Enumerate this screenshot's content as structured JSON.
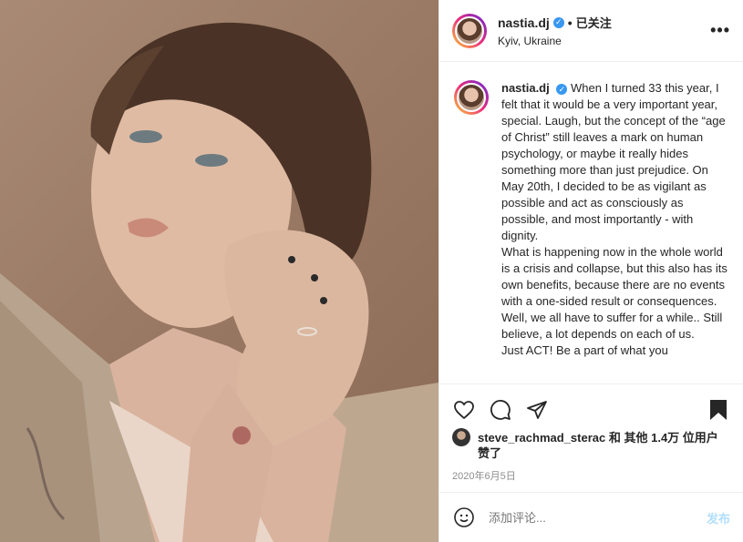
{
  "post": {
    "author": {
      "username": "nastia.dj",
      "verified": true,
      "follow_label": "已关注",
      "location": "Kyiv, Ukraine"
    },
    "caption": {
      "username": "nastia.dj",
      "paragraph_1": "When I turned 33 this year, I felt that it would be a very important year, special. Laugh, but the concept of the “age of Christ” still leaves a mark on human psychology, or maybe it really hides something more than just prejudice. On May 20th, I decided to be as vigilant as possible and act as consciously as possible, and most importantly - with dignity.",
      "paragraph_2": "What is happening now in the whole world is a crisis and collapse, but this also has its own benefits, because there are no events with a one-sided result or consequences. Well, we all have to suffer for a while.. Still believe, a lot depends on each of us.",
      "paragraph_3": "Just ACT! Be a part of what you"
    },
    "likes": {
      "liked_by": "steve_rachmad_sterac",
      "and_label": "和",
      "others": "其他 1.4万 位用户",
      "liked_label": "赞了"
    },
    "date": "2020年6月5日",
    "comment_input": {
      "placeholder": "添加评论..."
    },
    "post_button": "发布"
  },
  "icons": {
    "more": "more-horizontal-icon",
    "like": "heart-icon",
    "comment": "comment-bubble-icon",
    "share": "paper-plane-icon",
    "save": "bookmark-icon",
    "emoji": "smiley-icon"
  },
  "colors": {
    "verified": "#3897f0",
    "post_button": "#b2dffc",
    "muted_text": "#8e8e8e",
    "photo_background": "#9a7a64"
  }
}
